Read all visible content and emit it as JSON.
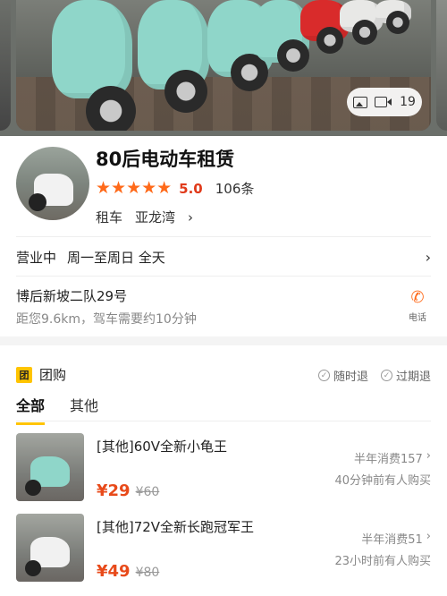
{
  "banner": {
    "media_count": "19"
  },
  "shop": {
    "name": "80后电动车租赁",
    "stars": "★★★★★",
    "score": "5.0",
    "reviews": "106条",
    "category": "租车",
    "area": "亚龙湾",
    "chevron": "›"
  },
  "hours": {
    "status": "营业中",
    "schedule": "周一至周日 全天",
    "chevron": "›"
  },
  "location": {
    "address": "博后新坡二队29号",
    "distance": "距您9.6km，驾车需要约10分钟",
    "phone_label": "电话"
  },
  "group": {
    "badge": "团",
    "title": "团购",
    "guarantee_1": "随时退",
    "guarantee_2": "过期退",
    "tabs": [
      "全部",
      "其他"
    ]
  },
  "deals": [
    {
      "title": "[其他]60V全新小龟王",
      "price": "¥29",
      "original_price": "¥60",
      "sales": "半年消费157",
      "recent": "40分钟前有人购买"
    },
    {
      "title": "[其他]72V全新长跑冠军王",
      "price": "¥49",
      "original_price": "¥80",
      "sales": "半年消费51",
      "recent": "23小时前有人购买"
    }
  ],
  "colors": {
    "accent": "#ff6a1a",
    "price": "#e84a1a",
    "tab_underline": "#ffc400"
  },
  "icons": [
    "image-icon",
    "video-icon",
    "star-icon",
    "chevron-right-icon",
    "phone-icon",
    "check-circle-icon",
    "tuan-badge-icon"
  ]
}
